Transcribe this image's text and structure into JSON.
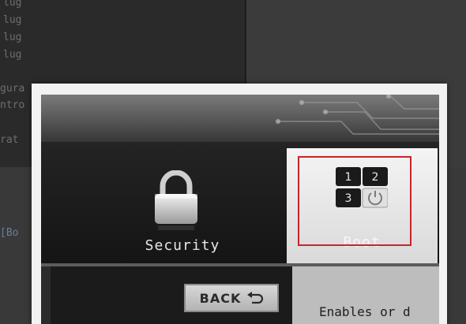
{
  "background": {
    "lines": [
      "lug",
      "lug",
      "lug",
      "lug",
      "gura",
      "ntro",
      "rat"
    ],
    "tag": "[Bo"
  },
  "bios": {
    "tiles": {
      "security": {
        "label": "Security",
        "icon": "padlock-icon"
      },
      "boot": {
        "label": "Boot",
        "icon": "boot-order-icon",
        "selected": true,
        "keys": [
          "1",
          "2",
          "3"
        ]
      }
    },
    "back_button": {
      "label": "BACK",
      "icon": "return-arrow-icon"
    },
    "description": "Enables or d"
  },
  "colors": {
    "highlight": "#c8242a",
    "selected_tile": "#e6e6e6",
    "dark": "#1b1b1b"
  }
}
